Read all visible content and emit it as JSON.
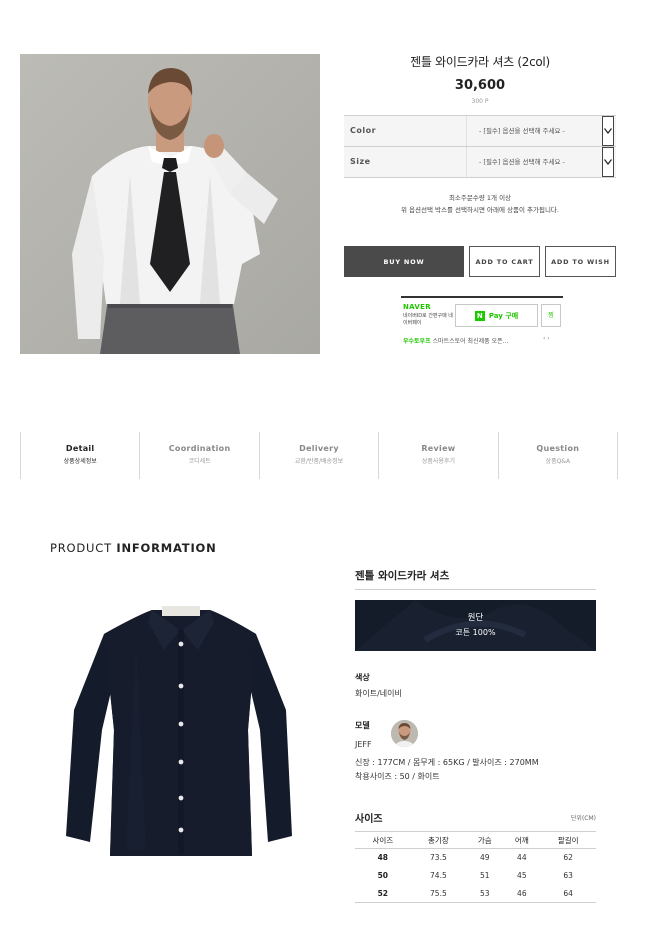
{
  "product": {
    "title": "젠틀 와이드카라 셔츠 (2col)",
    "price": "30,600",
    "point": "300 P"
  },
  "options": [
    {
      "label": "Color",
      "placeholder": "- [필수] 옵션을 선택해 주세요 -"
    },
    {
      "label": "Size",
      "placeholder": "- [필수] 옵션을 선택해 주세요 -"
    }
  ],
  "notes": {
    "min_qty": "최소주문수량 1개 이상",
    "guide": "위 옵션선택 박스를 선택하시면 아래에 상품이 추가됩니다."
  },
  "buttons": {
    "buy": "BUY NOW",
    "cart": "ADD TO CART",
    "wish": "ADD TO WISH"
  },
  "naverpay": {
    "logo": "NAVER",
    "desc": "네이버ID로 간편구매 네이버페이",
    "button": "Pay 구매",
    "zzim": "찜",
    "promo_label": "우수토우프",
    "promo_text": "스마트스토어 최신제품 오픈...",
    "arrows": "‹ ›",
    "colors": {
      "green": "#1ec800"
    }
  },
  "tabs": [
    {
      "en": "Detail",
      "ko": "상품상세정보",
      "active": true
    },
    {
      "en": "Coordination",
      "ko": "코디세트",
      "active": false
    },
    {
      "en": "Delivery",
      "ko": "교환/반품/배송정보",
      "active": false
    },
    {
      "en": "Review",
      "ko": "상품사용후기",
      "active": false
    },
    {
      "en": "Question",
      "ko": "상품Q&A",
      "active": false
    }
  ],
  "info": {
    "heading_light": "PRODUCT ",
    "heading_bold": "INFORMATION",
    "spec_title": "젠틀 와이드카라 셔츠",
    "fabric_label": "원단",
    "fabric_value": "코튼 100%",
    "color_label": "색상",
    "color_value": "화이트/네이비",
    "model_label": "모델",
    "model_name": "JEFF",
    "model_body": "신장 : 177CM / 몸무게 : 65KG / 발사이즈 : 270MM",
    "model_wear": "착용사이즈 : 50 / 화이트",
    "size_title": "사이즈",
    "size_unit": "단위(CM)"
  },
  "size_table": {
    "headers": [
      "사이즈",
      "총기장",
      "가슴",
      "어깨",
      "팔길이"
    ],
    "rows": [
      [
        "48",
        "73.5",
        "49",
        "44",
        "62"
      ],
      [
        "50",
        "74.5",
        "51",
        "45",
        "63"
      ],
      [
        "52",
        "75.5",
        "53",
        "46",
        "64"
      ]
    ]
  },
  "colors": {
    "accent_dark": "#4a4a4a",
    "navy_shirt": "#141b29"
  }
}
